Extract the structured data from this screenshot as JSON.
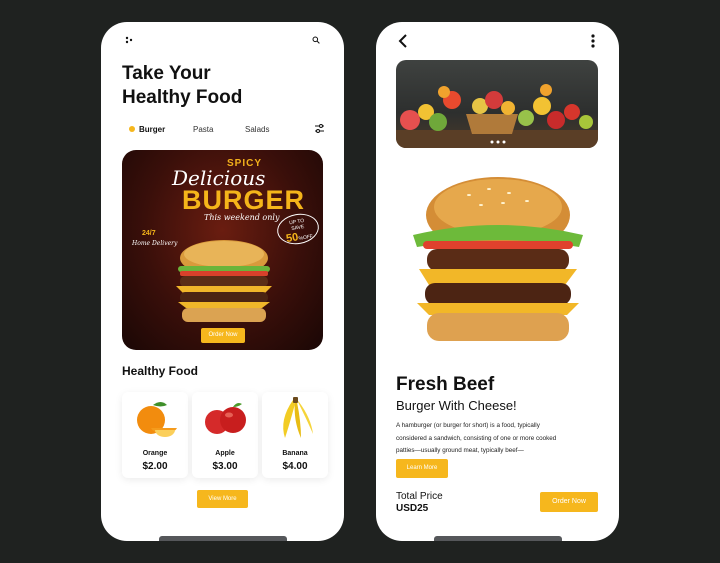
{
  "home": {
    "title_line1": "Take Your",
    "title_line2": "Healthy Food",
    "categories": [
      {
        "label": "Burger"
      },
      {
        "label": "Pasta"
      },
      {
        "label": "Salads"
      }
    ],
    "promo": {
      "spicy": "SPICY",
      "delicious": "Delicious",
      "burger": "BURGER",
      "weekend": "This weekend only",
      "hours": "24/7",
      "delivery": "Home Delivery",
      "badge_top": "UP TO",
      "badge_save": "SAVE",
      "badge_value": "50",
      "badge_off": "%OFF",
      "order_label": "Order Now"
    },
    "section_title": "Healthy Food",
    "foods": [
      {
        "name": "Orange",
        "price": "$2.00"
      },
      {
        "name": "Apple",
        "price": "$3.00"
      },
      {
        "name": "Banana",
        "price": "$4.00"
      }
    ],
    "view_more_label": "View More"
  },
  "detail": {
    "name": "Fresh Beef",
    "subtitle": "Burger With Cheese!",
    "description": "A hamburger (or burger for short) is a food, typically considered a sandwich, consisting of one or more cooked patties—usually ground meat, typically beef—",
    "learn_more_label": "Learn More",
    "price_label": "Total Price",
    "price_value": "USD25",
    "order_label": "Order Now"
  },
  "colors": {
    "accent": "#f6b71d",
    "background": "#1f2220"
  }
}
